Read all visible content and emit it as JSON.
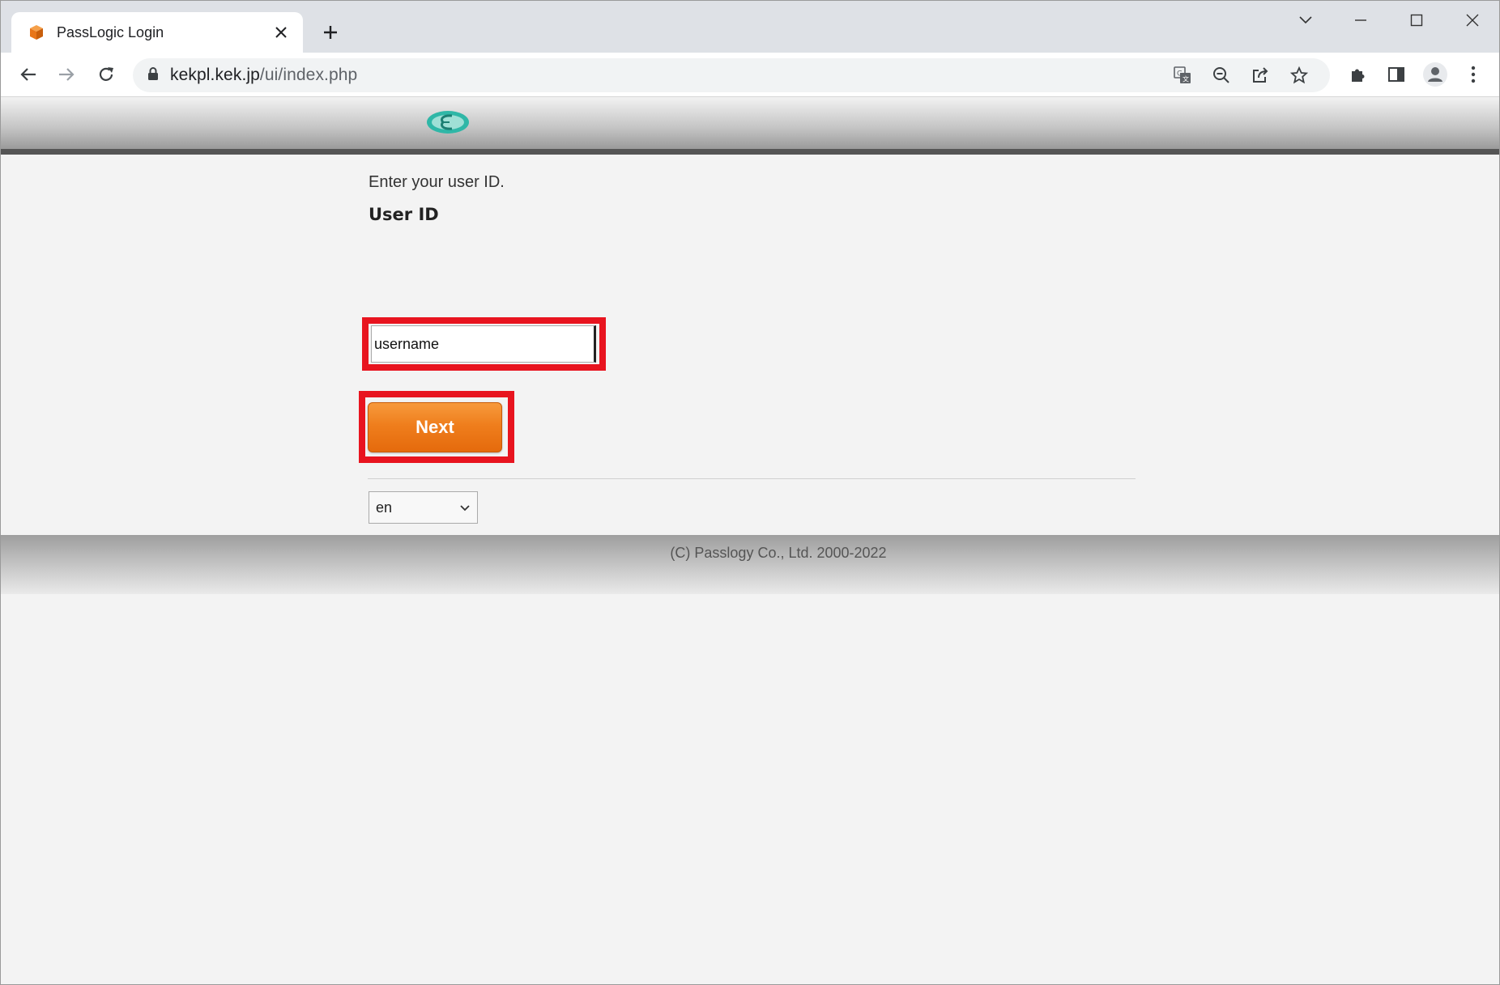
{
  "browser": {
    "tab_title": "PassLogic Login",
    "url_host": "kekpl.kek.jp",
    "url_path": "/ui/index.php",
    "icons": {
      "tab_favicon": "package-icon",
      "tab_close": "close-icon",
      "new_tab": "plus-icon",
      "tab_search": "chevron-down-icon",
      "minimize": "minimize-icon",
      "maximize": "maximize-icon",
      "close": "close-icon",
      "back": "arrow-left-icon",
      "forward": "arrow-right-icon",
      "reload": "reload-icon",
      "secure": "lock-icon",
      "translate": "translate-icon",
      "zoom": "zoom-out-icon",
      "share": "share-icon",
      "bookmark": "star-icon",
      "extensions": "puzzle-icon",
      "side_panel": "side-panel-icon",
      "profile": "profile-icon",
      "menu": "kebab-menu-icon"
    }
  },
  "login": {
    "prompt": "Enter your user ID.",
    "user_id_label": "User ID",
    "user_id_value": "username",
    "next_label": "Next",
    "language_value": "en"
  },
  "footer": {
    "copyright": "(C) Passlogy Co., Ltd. 2000-2022"
  },
  "colors": {
    "accent_orange": "#ef7e1d",
    "highlight_red": "#e8141f",
    "logo_teal": "#2fb7a7"
  }
}
